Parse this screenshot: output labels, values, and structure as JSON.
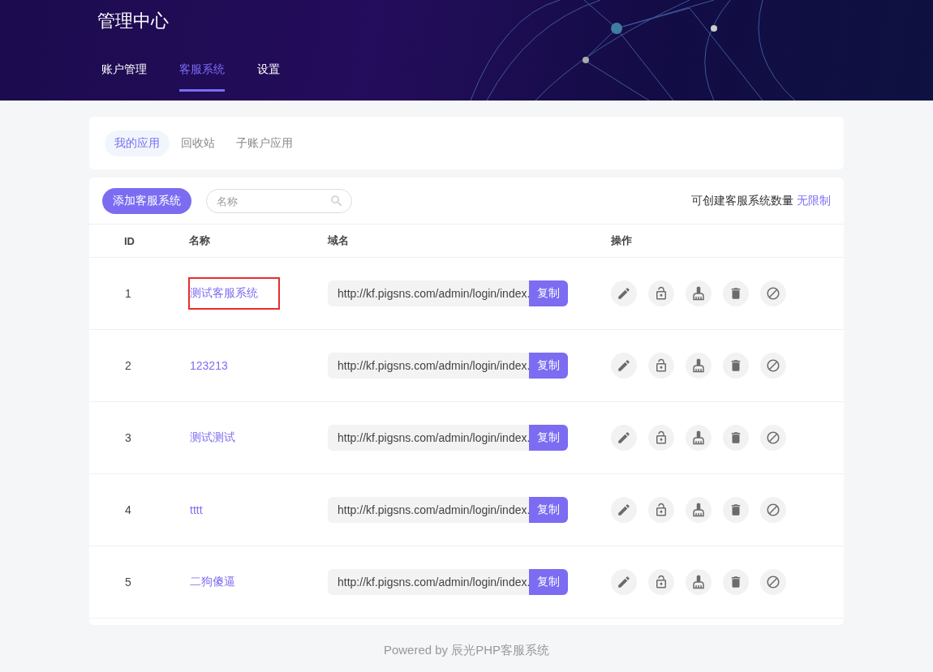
{
  "header": {
    "title": "管理中心",
    "nav": [
      {
        "label": "账户管理",
        "selected": false
      },
      {
        "label": "客服系统",
        "selected": true
      },
      {
        "label": "设置",
        "selected": false
      }
    ]
  },
  "subtabs": [
    {
      "label": "我的应用",
      "selected": true
    },
    {
      "label": "回收站",
      "selected": false
    },
    {
      "label": "子账户应用",
      "selected": false
    }
  ],
  "toolbar": {
    "add_button": "添加客服系统",
    "search": {
      "placeholder": "名称"
    },
    "quota_label": "可创建客服系统数量",
    "quota_value": "无限制"
  },
  "table": {
    "columns": [
      "ID",
      "名称",
      "域名",
      "操作"
    ],
    "rows": [
      {
        "id": "1",
        "name": "测试客服系统",
        "url": "http://kf.pigsns.com/admin/login/index.",
        "copy_label": "复制",
        "highlighted": true
      },
      {
        "id": "2",
        "name": "123213",
        "url": "http://kf.pigsns.com/admin/login/index.",
        "copy_label": "复制",
        "highlighted": false
      },
      {
        "id": "3",
        "name": "测试测试",
        "url": "http://kf.pigsns.com/admin/login/index.",
        "copy_label": "复制",
        "highlighted": false
      },
      {
        "id": "4",
        "name": "tttt",
        "url": "http://kf.pigsns.com/admin/login/index.",
        "copy_label": "复制",
        "highlighted": false
      },
      {
        "id": "5",
        "name": "二狗傻逼",
        "url": "http://kf.pigsns.com/admin/login/index.",
        "copy_label": "复制",
        "highlighted": false
      }
    ]
  },
  "footer": "Powered by 辰光PHP客服系统"
}
